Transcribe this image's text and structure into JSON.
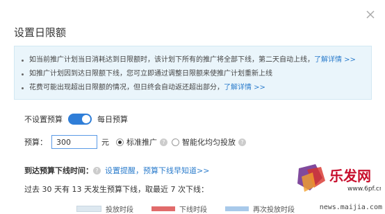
{
  "dialog": {
    "title": "设置日限额",
    "info_lines": [
      {
        "text": "如当前推广计划当日消耗达到日限额时，该计划下所有的推广将全部下线，第二天自动上线，",
        "link": "了解详情 >>"
      },
      {
        "text": "如推广计划因到达日限额下线，您可立即通过调整日限额来使推广计划重新上线",
        "link": ""
      },
      {
        "text": "花费可能出现超出日限额的情况，但日终会自动返还超出部分，",
        "link": "了解详情 >>"
      }
    ]
  },
  "budget_toggle": {
    "left_label": "不设置预算",
    "right_label": "每日预算",
    "on": true
  },
  "budget": {
    "label": "预算：",
    "value": "300",
    "unit": "元",
    "options": [
      {
        "label": "标准推广",
        "selected": true
      },
      {
        "label": "智能化均匀投放",
        "selected": false
      }
    ]
  },
  "offline_time": {
    "label": "到达预算下线时间：",
    "link": "设置提醒，预算下线早知道>>"
  },
  "history_text": "过去 30 天有 13 天发生预算下线，取最近 7 次下线：",
  "legend": [
    {
      "label": "投放时段",
      "color": "#dde8f0"
    },
    {
      "label": "下线时段",
      "color": "#e16b6b"
    },
    {
      "label": "再次投放时段",
      "color": "#a8c9ea"
    }
  ],
  "watermark": {
    "text": "news.maijia.com",
    "brand": "乐发网",
    "site": "www.6pf.cn"
  }
}
